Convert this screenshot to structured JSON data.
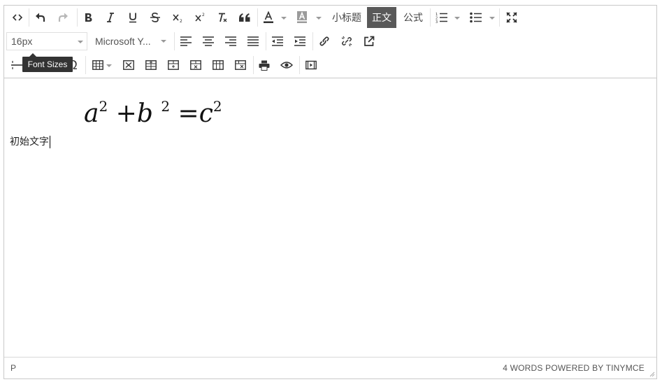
{
  "toolbar": {
    "row1": {
      "code": "source-code-icon",
      "undo": "undo-icon",
      "redo": "redo-icon",
      "bold": "bold-icon",
      "italic": "italic-icon",
      "underline": "underline-icon",
      "strikethrough": "strikethrough-icon",
      "subscript": "subscript-icon",
      "superscript": "superscript-icon",
      "clear_format": "clear-format-icon",
      "blockquote": "blockquote-icon",
      "text_color": "text-color-icon",
      "bg_color": "background-color-icon",
      "heading_label": "小标题",
      "body_label": "正文",
      "formula_label": "公式",
      "numbered_list": "numbered-list-icon",
      "bullet_list": "bullet-list-icon",
      "fullscreen": "fullscreen-icon"
    },
    "row2": {
      "font_size_value": "16px",
      "font_family_value": "Microsoft Y...",
      "align_left": "align-left-icon",
      "align_center": "align-center-icon",
      "align_right": "align-right-icon",
      "justify": "justify-icon",
      "outdent": "outdent-icon",
      "indent": "indent-icon",
      "link": "link-icon",
      "unlink": "unlink-icon",
      "open_link": "open-link-icon"
    },
    "row3": {
      "hr": "horizontal-rule-icon",
      "special_char": "Ω",
      "table": "table-icon",
      "print": "print-icon",
      "preview": "preview-icon",
      "media": "media-icon"
    }
  },
  "tooltip": {
    "text": "Font Sizes"
  },
  "content": {
    "formula": {
      "a": "a",
      "b": "b",
      "c": "c",
      "exp": "2",
      "plus": "+",
      "equals": "="
    },
    "paragraph": "初始文字"
  },
  "statusbar": {
    "path": "P",
    "wordcount": "4 WORDS POWERED BY TINYMCE"
  },
  "colors": {
    "active_button_bg": "#595959",
    "tooltip_bg": "#333333",
    "border": "#c9c9c9"
  }
}
